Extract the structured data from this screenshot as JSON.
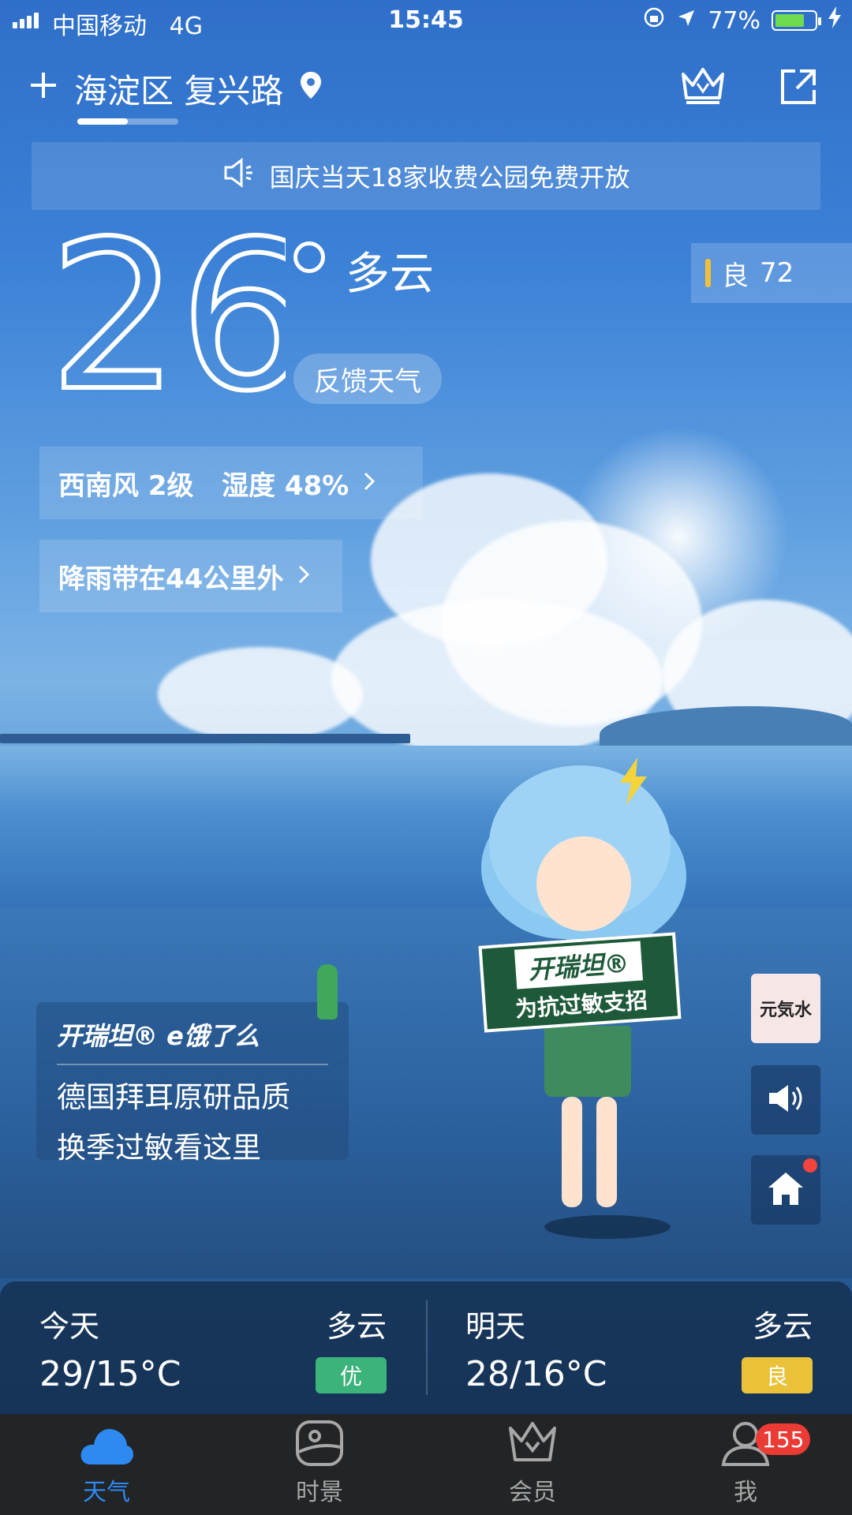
{
  "status_bar": {
    "carrier": "中国移动",
    "network": "4G",
    "time": "15:45",
    "battery": "77%"
  },
  "header": {
    "add_icon": "plus-icon",
    "location": "海淀区 复兴路",
    "location_icon": "location-pin-icon",
    "vip_icon": "crown-icon",
    "share_icon": "share-icon"
  },
  "notice": {
    "icon": "speaker-icon",
    "text": "国庆当天18家收费公园免费开放"
  },
  "current": {
    "temperature": "26",
    "condition": "多云",
    "feedback_label": "反馈天气",
    "aqi_label": "良",
    "aqi_value": "72",
    "aqi_color": "#f0c03a",
    "wind_humidity": "西南风 2级   湿度 48%",
    "rain": "降雨带在44公里外"
  },
  "ad": {
    "brand": "开瑞坦® e饿了么",
    "line1": "德国拜耳原研品质",
    "line2": "换季过敏看这里"
  },
  "character_sign": {
    "brand": "开瑞坦®",
    "slogan": "为抗过敏支招"
  },
  "side_buttons": {
    "drink_label": "元気水",
    "sound_icon": "speaker-icon",
    "home_icon": "home-icon"
  },
  "forecast": {
    "today": {
      "label": "今天",
      "condition": "多云",
      "range": "29/15°C",
      "quality": "优",
      "quality_color": "#3bb37a"
    },
    "tomorrow": {
      "label": "明天",
      "condition": "多云",
      "range": "28/16°C",
      "quality": "良",
      "quality_color": "#e9c23a"
    }
  },
  "tabs": [
    {
      "label": "天气",
      "icon": "cloud-icon",
      "active": true
    },
    {
      "label": "时景",
      "icon": "scenery-icon",
      "active": false
    },
    {
      "label": "会员",
      "icon": "crown-icon",
      "active": false
    },
    {
      "label": "我",
      "icon": "user-icon",
      "active": false,
      "badge": "155"
    }
  ]
}
